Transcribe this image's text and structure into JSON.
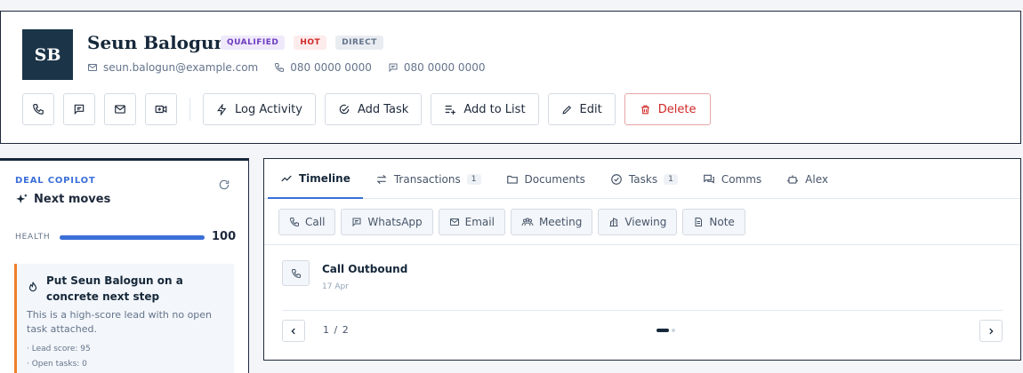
{
  "contact": {
    "initials": "SB",
    "name": "Seun Balogun",
    "badges": [
      "QUALIFIED",
      "HOT",
      "DIRECT"
    ],
    "email": "seun.balogun@example.com",
    "phone": "080 0000 0000",
    "whatsapp": "080 0000 0000"
  },
  "actions": {
    "log_activity": "Log Activity",
    "add_task": "Add Task",
    "add_to_list": "Add to List",
    "edit": "Edit",
    "delete": "Delete"
  },
  "copilot": {
    "tag": "DEAL COPILOT",
    "title": "Next moves",
    "health_label": "HEALTH",
    "health_value": "100",
    "health_fraction": 1.0,
    "suggestion": {
      "title": "Put Seun Balogun on a concrete next step",
      "description": "This is a high-score lead with no open task attached.",
      "meta": [
        "· Lead score: 95",
        "· Open tasks: 0"
      ]
    }
  },
  "tabs": [
    {
      "label": "Timeline",
      "count": ""
    },
    {
      "label": "Transactions",
      "count": "1"
    },
    {
      "label": "Documents",
      "count": ""
    },
    {
      "label": "Tasks",
      "count": "1"
    },
    {
      "label": "Comms",
      "count": ""
    },
    {
      "label": "Alex",
      "count": ""
    }
  ],
  "log_buttons": [
    "Call",
    "WhatsApp",
    "Email",
    "Meeting",
    "Viewing",
    "Note"
  ],
  "timeline": {
    "entry_title": "Call Outbound",
    "entry_date": "17 Apr",
    "page_text": "1 / 2"
  },
  "colors": {
    "accent": "#3b6fd8",
    "avatar_bg": "#1b3448",
    "danger": "#d02828",
    "warning_stripe": "#ef7f2a"
  }
}
